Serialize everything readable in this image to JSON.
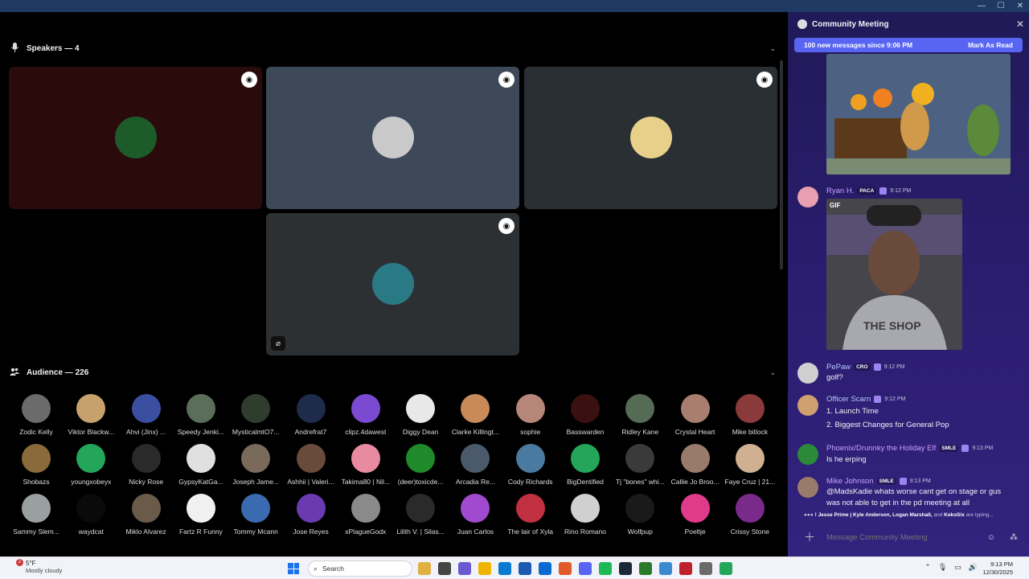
{
  "window": {
    "minimize": "—",
    "maximize": "☐",
    "close": "✕"
  },
  "stage": {
    "speakers_header": "Speakers — 4",
    "audience_header": "Audience — 226",
    "speaker_tiles": [
      {
        "bg": "#2b0a0c",
        "avatar": "#1d5c2a"
      },
      {
        "bg": "#3d4958",
        "avatar": "#c9c9c9"
      },
      {
        "bg": "#2a2f33",
        "avatar": "#e8d08a"
      },
      {
        "bg": "#2c3033",
        "avatar": "#2a7a86"
      }
    ],
    "audience_rows": [
      [
        {
          "name": "Zodic Kelly",
          "color": "#6b6b6b"
        },
        {
          "name": "Viktor Blackw...",
          "color": "#c7a16b"
        },
        {
          "name": "Ahvi (Jinx) ...",
          "color": "#3b4fa0"
        },
        {
          "name": "Speedy Jenki...",
          "color": "#5a6e5a"
        },
        {
          "name": "MysticalmtO7...",
          "color": "#2f3d2f"
        },
        {
          "name": "Andrefrat7",
          "color": "#1f2b4a"
        },
        {
          "name": "clipz.4dawest",
          "color": "#7a4bd1"
        },
        {
          "name": "Diggy Dean",
          "color": "#e8e8e8"
        },
        {
          "name": "Clarke Killingt...",
          "color": "#c98a5a"
        },
        {
          "name": "sophie",
          "color": "#b7867a"
        },
        {
          "name": "Basswarden",
          "color": "#3a1010"
        },
        {
          "name": "Ridley Kane",
          "color": "#556b55"
        },
        {
          "name": "Crystal Heart",
          "color": "#a87e6e"
        },
        {
          "name": "Mike bitlock",
          "color": "#8a3a3a"
        }
      ],
      [
        {
          "name": "Shobazs",
          "color": "#8a6a3a"
        },
        {
          "name": "youngxobeyx",
          "color": "#23a55a"
        },
        {
          "name": "Nicky Rose",
          "color": "#2a2a2a"
        },
        {
          "name": "GypsyKatGa...",
          "color": "#e0e0e0"
        },
        {
          "name": "Joseph Jame...",
          "color": "#7a6a5a"
        },
        {
          "name": "Ashhii | Valeri...",
          "color": "#6a4a3a"
        },
        {
          "name": "Takima80 | Nil...",
          "color": "#e88aa0"
        },
        {
          "name": "(deer)toxicde...",
          "color": "#1f8a2a"
        },
        {
          "name": "Arcadia Re...",
          "color": "#4a5a6a"
        },
        {
          "name": "Cody Richards",
          "color": "#4a7aa0"
        },
        {
          "name": "BigDentified",
          "color": "#23a55a"
        },
        {
          "name": "Tj \"bones\" whi...",
          "color": "#3a3a3a"
        },
        {
          "name": "Callie Jo Broo...",
          "color": "#9a7a6a"
        },
        {
          "name": "Faye Cruz | 21...",
          "color": "#d0b090"
        }
      ],
      [
        {
          "name": "Sammy Slem...",
          "color": "#9aa0a0"
        },
        {
          "name": "waydcat",
          "color": "#0a0a0a"
        },
        {
          "name": "Miklo Alvarez",
          "color": "#6a5a4a"
        },
        {
          "name": "Fartz R Funny",
          "color": "#f0f0f0"
        },
        {
          "name": "Tommy Mcann",
          "color": "#3a6ab0"
        },
        {
          "name": "Jose Reyes",
          "color": "#6a3ab0"
        },
        {
          "name": "xPlagueGodx",
          "color": "#8a8a8a"
        },
        {
          "name": "Lilith V. | Silas...",
          "color": "#2a2a2a"
        },
        {
          "name": "Juan Carlos",
          "color": "#a04ad0"
        },
        {
          "name": "The lair of Xyla",
          "color": "#c03040"
        },
        {
          "name": "Rino Romano",
          "color": "#d0d0d0"
        },
        {
          "name": "Wolfpup",
          "color": "#1a1a1a"
        },
        {
          "name": "Poeltje",
          "color": "#e03a8a"
        },
        {
          "name": "Crissy Stone",
          "color": "#7a2a8a"
        }
      ]
    ]
  },
  "chat": {
    "title": "Community Meeting",
    "close": "✕",
    "new_messages": "100 new messages since 9:06 PM",
    "mark_read": "Mark As Read",
    "gif_tag": "GIF",
    "gif_caption": "THE SHOP",
    "messages": [
      {
        "user": "Ryan H.",
        "user_color": "#c9a0ff",
        "badge": "PACA",
        "time": "9:12 PM",
        "lines": [],
        "avatar": "#e8a0b0"
      },
      {
        "user": "PePaw",
        "user_color": "#b5c9ff",
        "badge": "CRO",
        "time": "9:12 PM",
        "lines": [
          "golf?"
        ],
        "avatar": "#d0d0d0"
      },
      {
        "user": "Officer Scarn",
        "user_color": "#b5c9ff",
        "badge": "",
        "time": "9:12 PM",
        "lines": [
          "1. Launch Time",
          "2. Biggest Changes for General Pop"
        ],
        "avatar": "#d0a070"
      },
      {
        "user": "Phoenix/Drunnky the Holiday Elf",
        "user_color": "#c9a0ff",
        "badge": "SMLE",
        "time": "9:13 PM",
        "lines": [
          "Is he erping"
        ],
        "avatar": "#2a8a3a"
      },
      {
        "user": "Mike Johnson",
        "user_color": "#c9a0ff",
        "badge": "SMLE",
        "time": "9:13 PM",
        "lines": [
          "@MadsKadie  whats worse cant get on stage or gus",
          "was not able to get in the pd meeting at all"
        ],
        "avatar": "#9a7a6a"
      }
    ],
    "typing_names": "! Jesse Prime | Kyle Anderson, Logan Marshall,",
    "typing_and": "and",
    "typing_last": "KekoSix",
    "typing_suffix": "are typing...",
    "input_placeholder": "Message Community Meeting"
  },
  "taskbar": {
    "weather_temp": "5°F",
    "weather_desc": "Mostly cloudy",
    "weather_badge": "2",
    "search_placeholder": "Search",
    "time": "9:13 PM",
    "date": "12/30/2025",
    "apps": [
      "#e0b040",
      "#444",
      "#6a5ad0",
      "#f0b400",
      "#0a7ad0",
      "#1a5ab0",
      "#0a6ad0",
      "#e05a2a",
      "#5865f2",
      "#1db954",
      "#1b2838",
      "#2a7a2a",
      "#3a8ad0",
      "#c0202a",
      "#6a6a6a",
      "#23a55a"
    ]
  }
}
